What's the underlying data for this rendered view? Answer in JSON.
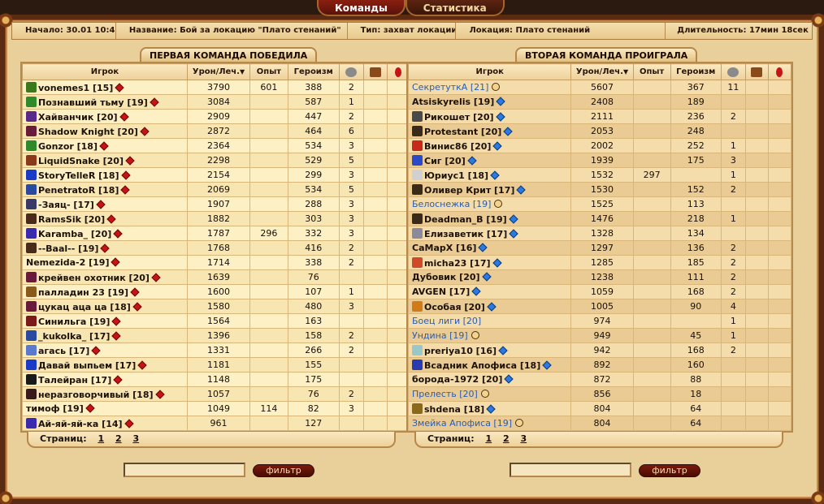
{
  "tabs": [
    {
      "label": "Команды",
      "active": true
    },
    {
      "label": "Статистика",
      "active": false
    }
  ],
  "info": {
    "start_label": "Начало:",
    "start_value": "30.01 10:47",
    "name_label": "Название:",
    "name_value": "Бой за локацию \"Плато стенаний\"",
    "type_label": "Тип:",
    "type_value": "захват локации",
    "location_label": "Локация:",
    "location_value": "Плато стенаний",
    "duration_label": "Длительность:",
    "duration_value": "17мин 18сек"
  },
  "columns": {
    "player": "Игрок",
    "damage": "Урон/Леч.",
    "exp": "Опыт",
    "heroism": "Героизм"
  },
  "left": {
    "title": "ПЕРВАЯ КОМАНДА ПОБЕДИЛА",
    "rows": [
      {
        "icon": "wolf-clan-icon",
        "icon_color": "#3a7a1a",
        "name": "vonemes1 [15]",
        "align": "red",
        "dmg": "3790",
        "exp": "601",
        "hero": "388",
        "kills": "2"
      },
      {
        "icon": "dragon-clan-icon",
        "icon_color": "#2e8a2a",
        "name": "Познавший тьму [19]",
        "align": "red",
        "dmg": "3084",
        "exp": "",
        "hero": "587",
        "kills": "1"
      },
      {
        "icon": "demon-clan-icon",
        "icon_color": "#5a2a8a",
        "name": "Хайванчик [20]",
        "align": "red",
        "dmg": "2909",
        "exp": "",
        "hero": "447",
        "kills": "2"
      },
      {
        "icon": "skull-clan-icon",
        "icon_color": "#6a1a3a",
        "name": "Shadow Knight [20]",
        "align": "red",
        "dmg": "2872",
        "exp": "",
        "hero": "464",
        "kills": "6"
      },
      {
        "icon": "dragon-clan-icon",
        "icon_color": "#2e8a2a",
        "name": "Gonzor [18]",
        "align": "red",
        "dmg": "2364",
        "exp": "",
        "hero": "534",
        "kills": "3"
      },
      {
        "icon": "horn-clan-icon",
        "icon_color": "#8a3a1a",
        "name": "LiquidSnake [20]",
        "align": "red",
        "dmg": "2298",
        "exp": "",
        "hero": "529",
        "kills": "5"
      },
      {
        "icon": "blue-skull-clan-icon",
        "icon_color": "#1a3ac8",
        "name": "StoryTelleR [18]",
        "align": "red",
        "dmg": "2154",
        "exp": "",
        "hero": "299",
        "kills": "3"
      },
      {
        "icon": "star-clan-icon",
        "icon_color": "#2a4aa0",
        "name": "PenetratoR [18]",
        "align": "red",
        "dmg": "2069",
        "exp": "",
        "hero": "534",
        "kills": "5"
      },
      {
        "icon": "triangle-clan-icon",
        "icon_color": "#3a3a6a",
        "name": "-Заяц- [17]",
        "align": "red",
        "dmg": "1907",
        "exp": "",
        "hero": "288",
        "kills": "3"
      },
      {
        "icon": "crest-clan-icon",
        "icon_color": "#4a2a1a",
        "name": "RamsSik [20]",
        "align": "red",
        "dmg": "1882",
        "exp": "",
        "hero": "303",
        "kills": "3"
      },
      {
        "icon": "crystal-clan-icon",
        "icon_color": "#3a2ab0",
        "name": "Karamba_ [20]",
        "align": "red",
        "dmg": "1787",
        "exp": "296",
        "hero": "332",
        "kills": "3"
      },
      {
        "icon": "crest-clan-icon",
        "icon_color": "#4a2a1a",
        "name": "--Baal-- [19]",
        "align": "red",
        "dmg": "1768",
        "exp": "",
        "hero": "416",
        "kills": "2"
      },
      {
        "icon": "",
        "icon_color": "",
        "name": "Nemezida-2 [19]",
        "align": "red",
        "dmg": "1714",
        "exp": "",
        "hero": "338",
        "kills": "2"
      },
      {
        "icon": "skull-clan-icon",
        "icon_color": "#6a1a3a",
        "name": "крейвен охотник [20]",
        "align": "red",
        "dmg": "1639",
        "exp": "",
        "hero": "76",
        "kills": ""
      },
      {
        "icon": "orc-clan-icon",
        "icon_color": "#8a5a1a",
        "name": "палладин 23 [19]",
        "align": "red",
        "dmg": "1600",
        "exp": "",
        "hero": "107",
        "kills": "1"
      },
      {
        "icon": "skull-clan-icon",
        "icon_color": "#6a1a3a",
        "name": "цукац ацa ца [18]",
        "align": "red",
        "dmg": "1580",
        "exp": "",
        "hero": "480",
        "kills": "3"
      },
      {
        "icon": "sword-clan-icon",
        "icon_color": "#7a1a1a",
        "name": "Синильга [19]",
        "align": "red",
        "dmg": "1564",
        "exp": "",
        "hero": "163",
        "kills": ""
      },
      {
        "icon": "star-clan-icon",
        "icon_color": "#2a4aa0",
        "name": "_kukolka_ [17]",
        "align": "red",
        "dmg": "1396",
        "exp": "",
        "hero": "158",
        "kills": "2"
      },
      {
        "icon": "crown-clan-icon",
        "icon_color": "#5a7ad0",
        "name": "агась [17]",
        "align": "red",
        "dmg": "1331",
        "exp": "",
        "hero": "266",
        "kills": "2"
      },
      {
        "icon": "blue-skull-clan-icon",
        "icon_color": "#1a3ac8",
        "name": "Давай выпьем [17]",
        "align": "red",
        "dmg": "1181",
        "exp": "",
        "hero": "155",
        "kills": ""
      },
      {
        "icon": "flag-clan-icon",
        "icon_color": "#1a1a1a",
        "name": "Талейран [17]",
        "align": "red",
        "dmg": "1148",
        "exp": "",
        "hero": "175",
        "kills": ""
      },
      {
        "icon": "castle-clan-icon",
        "icon_color": "#3a1a1a",
        "name": "неразговорчивый [18]",
        "align": "red",
        "dmg": "1057",
        "exp": "",
        "hero": "76",
        "kills": "2"
      },
      {
        "icon": "",
        "icon_color": "",
        "name": "тимоф [19]",
        "align": "red",
        "dmg": "1049",
        "exp": "114",
        "hero": "82",
        "kills": "3"
      },
      {
        "icon": "crystal-clan-icon",
        "icon_color": "#3a2ab0",
        "name": "Ай-яй-яй-ка [14]",
        "align": "red",
        "dmg": "961",
        "exp": "",
        "hero": "127",
        "kills": ""
      }
    ],
    "pager_label": "Страниц:",
    "pages": [
      "1",
      "2",
      "3"
    ],
    "filter_label": "фильтр"
  },
  "right": {
    "title": "ВТОРАЯ КОМАНДА ПРОИГРАЛА",
    "rows": [
      {
        "icon": "",
        "icon_color": "",
        "name": "СекретуткА [21]",
        "bot": true,
        "align": "neutral",
        "dmg": "5607",
        "exp": "",
        "hero": "367",
        "kills": "11"
      },
      {
        "icon": "",
        "icon_color": "",
        "name": "Atsiskyrelis [19]",
        "align": "blue",
        "dmg": "2408",
        "exp": "",
        "hero": "189",
        "kills": ""
      },
      {
        "icon": "mask-clan-icon",
        "icon_color": "#4a4a4a",
        "name": "Рикошет [20]",
        "align": "blue",
        "dmg": "2111",
        "exp": "",
        "hero": "236",
        "kills": "2"
      },
      {
        "icon": "swords-clan-icon",
        "icon_color": "#3a2a1a",
        "name": "Protestant [20]",
        "align": "blue",
        "dmg": "2053",
        "exp": "",
        "hero": "248",
        "kills": ""
      },
      {
        "icon": "question-clan-icon",
        "icon_color": "#c82a1a",
        "name": "Винис86 [20]",
        "align": "blue",
        "dmg": "2002",
        "exp": "",
        "hero": "252",
        "kills": "1"
      },
      {
        "icon": "banner-clan-icon",
        "icon_color": "#2a4ac8",
        "name": "Сиг [20]",
        "align": "blue",
        "dmg": "1939",
        "exp": "",
        "hero": "175",
        "kills": "3"
      },
      {
        "icon": "white-skull-clan-icon",
        "icon_color": "#d0d0d0",
        "name": "Юриус1 [18]",
        "align": "blue",
        "dmg": "1532",
        "exp": "297",
        "hero": "",
        "kills": "1"
      },
      {
        "icon": "swords-clan-icon",
        "icon_color": "#3a2a1a",
        "name": "Оливер Крит [17]",
        "align": "blue",
        "dmg": "1530",
        "exp": "",
        "hero": "152",
        "kills": "2"
      },
      {
        "icon": "",
        "icon_color": "",
        "name": "Белоснежка [19]",
        "bot": true,
        "align": "neutral",
        "dmg": "1525",
        "exp": "",
        "hero": "113",
        "kills": ""
      },
      {
        "icon": "swords-clan-icon",
        "icon_color": "#3a2a1a",
        "name": "Deadman_B [19]",
        "align": "blue",
        "dmg": "1476",
        "exp": "",
        "hero": "218",
        "kills": "1"
      },
      {
        "icon": "shield-clan-icon",
        "icon_color": "#8a8a9a",
        "name": "Елизаветик [17]",
        "align": "blue",
        "dmg": "1328",
        "exp": "",
        "hero": "134",
        "kills": ""
      },
      {
        "icon": "",
        "icon_color": "",
        "name": "CaMapX [16]",
        "align": "blue",
        "dmg": "1297",
        "exp": "",
        "hero": "136",
        "kills": "2"
      },
      {
        "icon": "flower-clan-icon",
        "icon_color": "#d04a2a",
        "name": "micha23 [17]",
        "align": "blue",
        "dmg": "1285",
        "exp": "",
        "hero": "185",
        "kills": "2"
      },
      {
        "icon": "",
        "icon_color": "",
        "name": "Дубовик [20]",
        "align": "blue",
        "dmg": "1238",
        "exp": "",
        "hero": "111",
        "kills": "2"
      },
      {
        "icon": "",
        "icon_color": "",
        "name": "AVGEN [17]",
        "align": "blue",
        "dmg": "1059",
        "exp": "",
        "hero": "168",
        "kills": "2"
      },
      {
        "icon": "sun-clan-icon",
        "icon_color": "#d07a1a",
        "name": "Особая [20]",
        "align": "blue",
        "dmg": "1005",
        "exp": "",
        "hero": "90",
        "kills": "4"
      },
      {
        "icon": "",
        "icon_color": "",
        "name": "Боец лиги [20]",
        "bot": true,
        "align": "",
        "dmg": "974",
        "exp": "",
        "hero": "",
        "kills": "1"
      },
      {
        "icon": "",
        "icon_color": "",
        "name": "Ундина  [19]",
        "bot": true,
        "align": "neutral",
        "dmg": "949",
        "exp": "",
        "hero": "45",
        "kills": "1"
      },
      {
        "icon": "white-skull-clan-icon",
        "icon_color": "#9ac8c8",
        "name": "preriya10 [16]",
        "align": "blue",
        "dmg": "942",
        "exp": "",
        "hero": "168",
        "kills": "2"
      },
      {
        "icon": "gear-clan-icon",
        "icon_color": "#2a3ab0",
        "name": "Всадник Апофиса [18]",
        "align": "blue",
        "dmg": "892",
        "exp": "",
        "hero": "160",
        "kills": ""
      },
      {
        "icon": "",
        "icon_color": "",
        "name": "борода-1972 [20]",
        "align": "blue",
        "dmg": "872",
        "exp": "",
        "hero": "88",
        "kills": ""
      },
      {
        "icon": "",
        "icon_color": "",
        "name": "Прелесть [20]",
        "bot": true,
        "align": "neutral",
        "dmg": "856",
        "exp": "",
        "hero": "18",
        "kills": ""
      },
      {
        "icon": "swords-clan-icon",
        "icon_color": "#8a6a1a",
        "name": "shdena [18]",
        "align": "blue",
        "dmg": "804",
        "exp": "",
        "hero": "64",
        "kills": ""
      },
      {
        "icon": "",
        "icon_color": "",
        "name": "Змейка Апофиса [19]",
        "bot": true,
        "align": "neutral",
        "dmg": "804",
        "exp": "",
        "hero": "64",
        "kills": ""
      }
    ],
    "pager_label": "Страниц:",
    "pages": [
      "1",
      "2",
      "3"
    ],
    "filter_label": "фильтр"
  }
}
